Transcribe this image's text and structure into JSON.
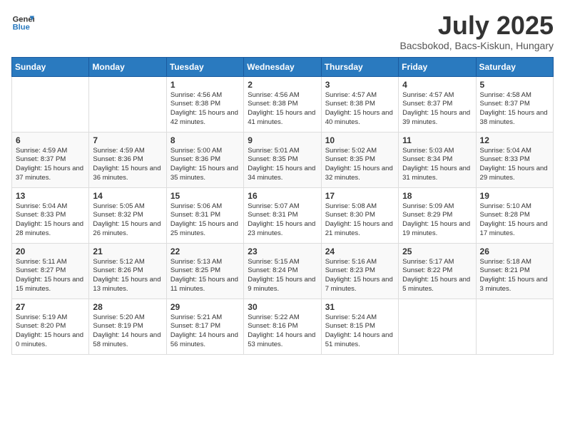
{
  "logo": {
    "general": "General",
    "blue": "Blue"
  },
  "title": "July 2025",
  "location": "Bacsbokod, Bacs-Kiskun, Hungary",
  "days_of_week": [
    "Sunday",
    "Monday",
    "Tuesday",
    "Wednesday",
    "Thursday",
    "Friday",
    "Saturday"
  ],
  "weeks": [
    [
      {
        "day": "",
        "info": ""
      },
      {
        "day": "",
        "info": ""
      },
      {
        "day": "1",
        "info": "Sunrise: 4:56 AM\nSunset: 8:38 PM\nDaylight: 15 hours and 42 minutes."
      },
      {
        "day": "2",
        "info": "Sunrise: 4:56 AM\nSunset: 8:38 PM\nDaylight: 15 hours and 41 minutes."
      },
      {
        "day": "3",
        "info": "Sunrise: 4:57 AM\nSunset: 8:38 PM\nDaylight: 15 hours and 40 minutes."
      },
      {
        "day": "4",
        "info": "Sunrise: 4:57 AM\nSunset: 8:37 PM\nDaylight: 15 hours and 39 minutes."
      },
      {
        "day": "5",
        "info": "Sunrise: 4:58 AM\nSunset: 8:37 PM\nDaylight: 15 hours and 38 minutes."
      }
    ],
    [
      {
        "day": "6",
        "info": "Sunrise: 4:59 AM\nSunset: 8:37 PM\nDaylight: 15 hours and 37 minutes."
      },
      {
        "day": "7",
        "info": "Sunrise: 4:59 AM\nSunset: 8:36 PM\nDaylight: 15 hours and 36 minutes."
      },
      {
        "day": "8",
        "info": "Sunrise: 5:00 AM\nSunset: 8:36 PM\nDaylight: 15 hours and 35 minutes."
      },
      {
        "day": "9",
        "info": "Sunrise: 5:01 AM\nSunset: 8:35 PM\nDaylight: 15 hours and 34 minutes."
      },
      {
        "day": "10",
        "info": "Sunrise: 5:02 AM\nSunset: 8:35 PM\nDaylight: 15 hours and 32 minutes."
      },
      {
        "day": "11",
        "info": "Sunrise: 5:03 AM\nSunset: 8:34 PM\nDaylight: 15 hours and 31 minutes."
      },
      {
        "day": "12",
        "info": "Sunrise: 5:04 AM\nSunset: 8:33 PM\nDaylight: 15 hours and 29 minutes."
      }
    ],
    [
      {
        "day": "13",
        "info": "Sunrise: 5:04 AM\nSunset: 8:33 PM\nDaylight: 15 hours and 28 minutes."
      },
      {
        "day": "14",
        "info": "Sunrise: 5:05 AM\nSunset: 8:32 PM\nDaylight: 15 hours and 26 minutes."
      },
      {
        "day": "15",
        "info": "Sunrise: 5:06 AM\nSunset: 8:31 PM\nDaylight: 15 hours and 25 minutes."
      },
      {
        "day": "16",
        "info": "Sunrise: 5:07 AM\nSunset: 8:31 PM\nDaylight: 15 hours and 23 minutes."
      },
      {
        "day": "17",
        "info": "Sunrise: 5:08 AM\nSunset: 8:30 PM\nDaylight: 15 hours and 21 minutes."
      },
      {
        "day": "18",
        "info": "Sunrise: 5:09 AM\nSunset: 8:29 PM\nDaylight: 15 hours and 19 minutes."
      },
      {
        "day": "19",
        "info": "Sunrise: 5:10 AM\nSunset: 8:28 PM\nDaylight: 15 hours and 17 minutes."
      }
    ],
    [
      {
        "day": "20",
        "info": "Sunrise: 5:11 AM\nSunset: 8:27 PM\nDaylight: 15 hours and 15 minutes."
      },
      {
        "day": "21",
        "info": "Sunrise: 5:12 AM\nSunset: 8:26 PM\nDaylight: 15 hours and 13 minutes."
      },
      {
        "day": "22",
        "info": "Sunrise: 5:13 AM\nSunset: 8:25 PM\nDaylight: 15 hours and 11 minutes."
      },
      {
        "day": "23",
        "info": "Sunrise: 5:15 AM\nSunset: 8:24 PM\nDaylight: 15 hours and 9 minutes."
      },
      {
        "day": "24",
        "info": "Sunrise: 5:16 AM\nSunset: 8:23 PM\nDaylight: 15 hours and 7 minutes."
      },
      {
        "day": "25",
        "info": "Sunrise: 5:17 AM\nSunset: 8:22 PM\nDaylight: 15 hours and 5 minutes."
      },
      {
        "day": "26",
        "info": "Sunrise: 5:18 AM\nSunset: 8:21 PM\nDaylight: 15 hours and 3 minutes."
      }
    ],
    [
      {
        "day": "27",
        "info": "Sunrise: 5:19 AM\nSunset: 8:20 PM\nDaylight: 15 hours and 0 minutes."
      },
      {
        "day": "28",
        "info": "Sunrise: 5:20 AM\nSunset: 8:19 PM\nDaylight: 14 hours and 58 minutes."
      },
      {
        "day": "29",
        "info": "Sunrise: 5:21 AM\nSunset: 8:17 PM\nDaylight: 14 hours and 56 minutes."
      },
      {
        "day": "30",
        "info": "Sunrise: 5:22 AM\nSunset: 8:16 PM\nDaylight: 14 hours and 53 minutes."
      },
      {
        "day": "31",
        "info": "Sunrise: 5:24 AM\nSunset: 8:15 PM\nDaylight: 14 hours and 51 minutes."
      },
      {
        "day": "",
        "info": ""
      },
      {
        "day": "",
        "info": ""
      }
    ]
  ]
}
